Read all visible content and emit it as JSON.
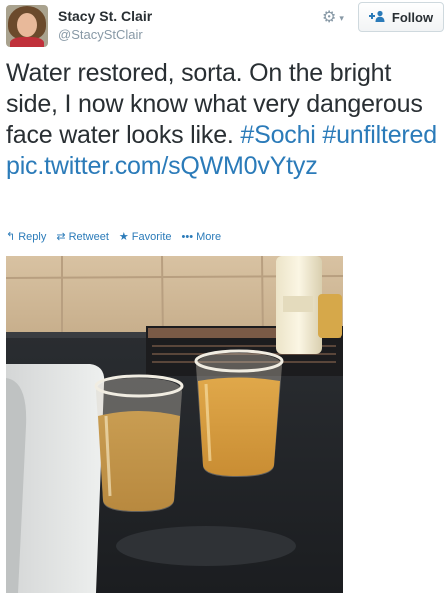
{
  "user": {
    "name": "Stacy St. Clair",
    "handle": "@StacyStClair"
  },
  "header": {
    "gear_glyph": "⚙",
    "caret_glyph": "▾",
    "follow_icon": "+👤",
    "follow_label": "Follow"
  },
  "tweet": {
    "text": "Water restored, sorta. On the bright side, I now know what very dangerous face water looks like. ",
    "hashtag1": "#Sochi",
    "hashtag2": "#unfiltered",
    "link": "pic.twitter.com/sQWM0vYtyz"
  },
  "actions": {
    "reply_icon": "↰",
    "reply": "Reply",
    "retweet_icon": "⇄",
    "retweet": "Retweet",
    "favorite_icon": "★",
    "favorite": "Favorite",
    "more_icon": "•••",
    "more": "More"
  },
  "colors": {
    "link": "#2b7bb9",
    "text": "#292f33",
    "muted": "#8899a6"
  },
  "icons": {
    "gear": "gear-icon",
    "follow": "add-user-icon",
    "reply": "reply-icon",
    "retweet": "retweet-icon",
    "favorite": "star-icon",
    "more": "more-dots-icon"
  },
  "photo": {
    "subject": "two glasses of yellow-brown tap water on a hotel bathroom counter"
  }
}
